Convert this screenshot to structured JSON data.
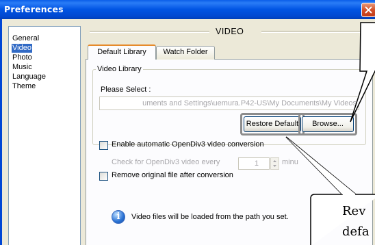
{
  "window": {
    "title": "Preferences",
    "close_icon": "close-x-icon"
  },
  "nav": {
    "items": [
      {
        "label": "General",
        "selected": false
      },
      {
        "label": "Video",
        "selected": true
      },
      {
        "label": "Photo",
        "selected": false
      },
      {
        "label": "Music",
        "selected": false
      },
      {
        "label": "Language",
        "selected": false
      },
      {
        "label": "Theme",
        "selected": false
      }
    ]
  },
  "section": {
    "title": "VIDEO"
  },
  "tabs": [
    {
      "label": "Default Library",
      "active": true
    },
    {
      "label": "Watch Folder",
      "active": false
    }
  ],
  "library": {
    "group_title": "Video Library",
    "select_label": "Please Select :",
    "path_value": "uments and Settings\\uemura.P42-US\\My Documents\\My Videos",
    "restore_label": "Restore Default",
    "browse_label": "Browse..."
  },
  "conversion": {
    "enable_label": "Enable automatic OpenDiv3 video conversion",
    "enable_checked": false,
    "check_every_label": "Check for OpenDiv3 video every",
    "check_every_value": "1",
    "minutes_label": "minu",
    "remove_label": "Remove original file after conversion",
    "remove_checked": false
  },
  "info": {
    "icon": "info-icon",
    "text": "Video files will be loaded from the path you set."
  },
  "callouts": {
    "bottom_line1": "Rev",
    "bottom_line2": "defa"
  },
  "colors": {
    "titlebar": "#0054e3",
    "selection": "#316ac5",
    "active_tab_accent": "#e68b2c",
    "callout_highlight": "#8c8c8c"
  }
}
